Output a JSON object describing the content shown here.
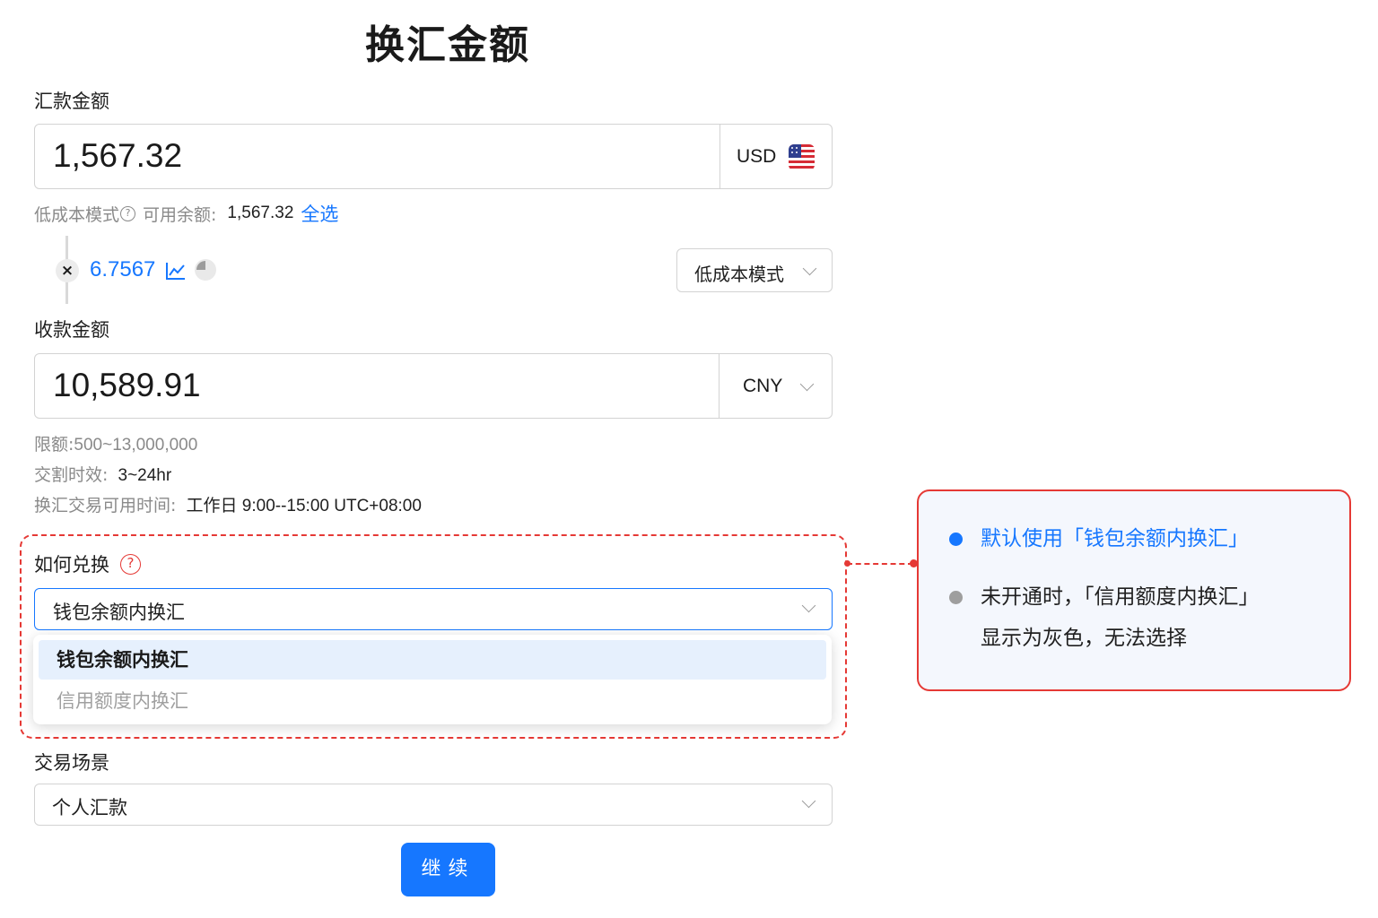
{
  "page": {
    "title": "换汇金额"
  },
  "send": {
    "label": "汇款金额",
    "amount": "1,567.32",
    "currency": "USD",
    "currency_icon": "us-flag-icon"
  },
  "balance": {
    "mode_label": "低成本模式",
    "help_icon": "?",
    "available_label": "可用余额:",
    "available_value": "1,567.32",
    "select_all": "全选"
  },
  "rate": {
    "multiply_symbol": "×",
    "value": "6.7567",
    "mode_select": "低成本模式"
  },
  "receive": {
    "label": "收款金额",
    "amount": "10,589.91",
    "currency": "CNY"
  },
  "info": {
    "limit_label": "限额:",
    "limit_value": "500~13,000,000",
    "settle_label": "交割时效:",
    "settle_value": "3~24hr",
    "hours_label": "换汇交易可用时间:",
    "hours_value": "工作日 9:00--15:00 UTC+08:00"
  },
  "exchange_method": {
    "label": "如何兑换",
    "help_icon": "?",
    "selected": "钱包余额内换汇",
    "options": [
      {
        "label": "钱包余额内换汇",
        "state": "selected"
      },
      {
        "label": "信用额度内换汇",
        "state": "disabled"
      }
    ]
  },
  "scenario": {
    "label": "交易场景",
    "selected": "个人汇款"
  },
  "continue_button": "继续",
  "annotation": {
    "item1": "默认使用「钱包余额内换汇」",
    "item2_line1": "未开通时，「信用额度内换汇」",
    "item2_line2": "显示为灰色，无法选择"
  },
  "colors": {
    "accent": "#1677ff",
    "annotation_red": "#e53935",
    "disabled_text": "#a0a0a0",
    "selected_option_bg": "#e6f0fd"
  }
}
